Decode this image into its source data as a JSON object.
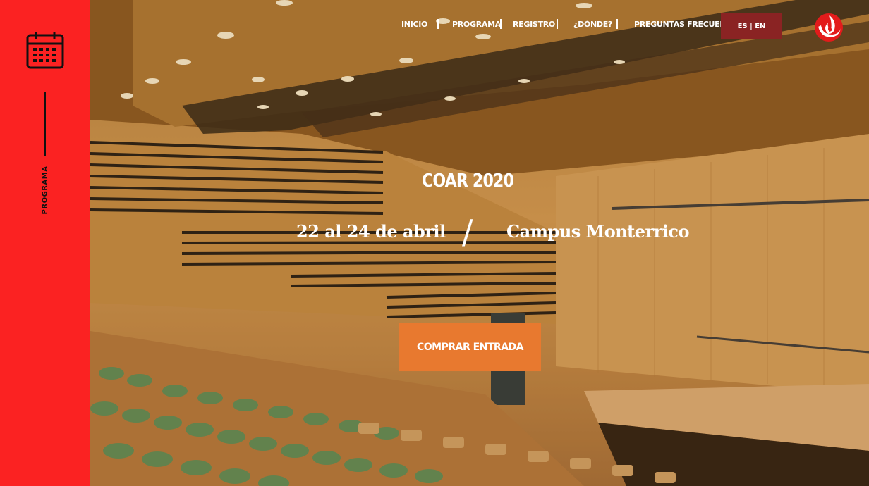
{
  "sidebar": {
    "label": "PROGRAMA",
    "icon": "calendar-icon"
  },
  "nav": {
    "items": [
      {
        "label": "INICIO"
      },
      {
        "label": "PROGRAMA"
      },
      {
        "label": "REGISTRO"
      },
      {
        "label": "¿DÓNDE?"
      },
      {
        "label": "PREGUNTAS FRECUENTES"
      }
    ],
    "language": "ES | EN",
    "logo": "upc-flame-logo"
  },
  "hero": {
    "title": "COAR 2020",
    "dates": "22 al 24 de abril",
    "separator": "/",
    "location": "Campus Monterrico",
    "cta_label": "COMPRAR ENTRADA",
    "background": "auditorium-photo"
  },
  "colors": {
    "sidebar": "#fb2222",
    "cta": "#e8792f",
    "language_button": "#8a2323",
    "logo": "#e31b1b"
  }
}
